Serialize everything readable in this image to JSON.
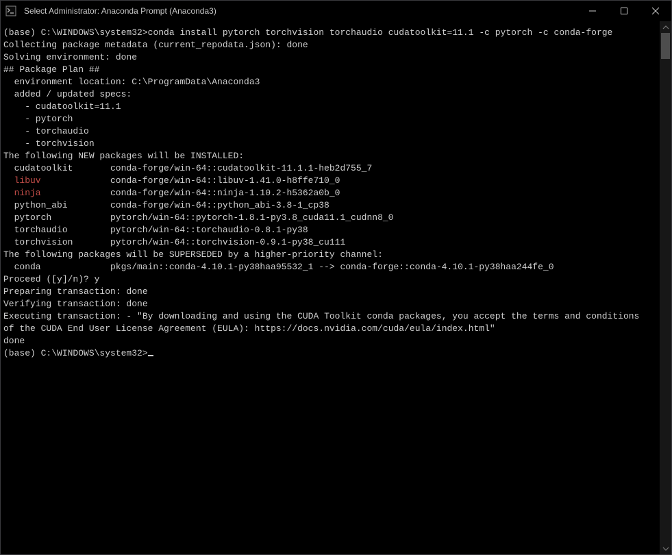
{
  "titlebar": {
    "title": "Select Administrator: Anaconda Prompt (Anaconda3)"
  },
  "terminal": {
    "prompt1": "(base) C:\\WINDOWS\\system32>",
    "command": "conda install pytorch torchvision torchaudio cudatoolkit=11.1 -c pytorch -c conda-forge",
    "collecting": "Collecting package metadata (current_repodata.json): done",
    "solving": "Solving environment: done",
    "plan_header": "## Package Plan ##",
    "env_location": "  environment location: C:\\ProgramData\\Anaconda3",
    "added_specs_header": "  added / updated specs:",
    "specs": [
      "    - cudatoolkit=11.1",
      "    - pytorch",
      "    - torchaudio",
      "    - torchvision"
    ],
    "new_pkgs_header": "The following NEW packages will be INSTALLED:",
    "new_packages": [
      {
        "name": "  cudatoolkit",
        "spec": "conda-forge/win-64::cudatoolkit-11.1.1-heb2d755_7",
        "color": "gray"
      },
      {
        "name": "  libuv",
        "spec": "conda-forge/win-64::libuv-1.41.0-h8ffe710_0",
        "color": "red"
      },
      {
        "name": "  ninja",
        "spec": "conda-forge/win-64::ninja-1.10.2-h5362a0b_0",
        "color": "red"
      },
      {
        "name": "  python_abi",
        "spec": "conda-forge/win-64::python_abi-3.8-1_cp38",
        "color": "gray"
      },
      {
        "name": "  pytorch",
        "spec": "pytorch/win-64::pytorch-1.8.1-py3.8_cuda11.1_cudnn8_0",
        "color": "gray"
      },
      {
        "name": "  torchaudio",
        "spec": "pytorch/win-64::torchaudio-0.8.1-py38",
        "color": "gray"
      },
      {
        "name": "  torchvision",
        "spec": "pytorch/win-64::torchvision-0.9.1-py38_cu111",
        "color": "gray"
      }
    ],
    "superseded_header": "The following packages will be SUPERSEDED by a higher-priority channel:",
    "superseded": [
      {
        "name": "  conda",
        "spec": "pkgs/main::conda-4.10.1-py38haa95532_1 --> conda-forge::conda-4.10.1-py38haa244fe_0"
      }
    ],
    "proceed": "Proceed ([y]/n)? y",
    "preparing": "Preparing transaction: done",
    "verifying": "Verifying transaction: done",
    "executing1": "Executing transaction: - \"By downloading and using the CUDA Toolkit conda packages, you accept the terms and conditions",
    "executing2": "of the CUDA End User License Agreement (EULA): https://docs.nvidia.com/cuda/eula/index.html\"",
    "done": "done",
    "prompt2": "(base) C:\\WINDOWS\\system32>"
  }
}
